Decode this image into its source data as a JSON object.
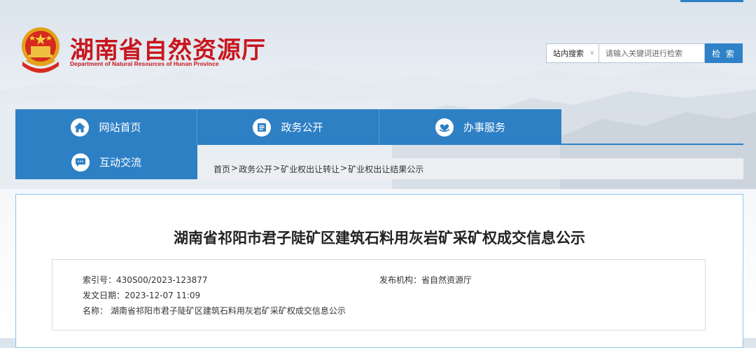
{
  "header": {
    "site_title": "湖南省自然资源厅",
    "site_subtitle": "Department of Natural Resources of Hunan Province",
    "emblem_icon": "national-emblem-icon"
  },
  "search": {
    "scope_label": "站内搜索",
    "scope_caret": "∨",
    "placeholder": "请输入关键词进行检索",
    "button_label": "检 索"
  },
  "nav": {
    "items": [
      {
        "label": "网站首页",
        "icon": "home-icon"
      },
      {
        "label": "政务公开",
        "icon": "document-list-icon"
      },
      {
        "label": "办事服务",
        "icon": "heart-hands-icon"
      },
      {
        "label": "互动交流",
        "icon": "chat-bubble-icon"
      }
    ]
  },
  "breadcrumb": {
    "items": [
      "首页",
      "政务公开",
      "矿业权出让转让",
      "矿业权出让结果公示"
    ],
    "separator": ">"
  },
  "article": {
    "title": "湖南省祁阳市君子陡矿区建筑石料用灰岩矿采矿权成交信息公示",
    "index_label": "索引号：",
    "index_value": "430S00/2023-123877",
    "publisher_label": "发布机构：",
    "publisher_value": "省自然资源厅",
    "date_label": "发文日期：",
    "date_value": "2023-12-07 11:09",
    "name_label": "名称：",
    "name_value": "湖南省祁阳市君子陡矿区建筑石料用灰岩矿采矿权成交信息公示"
  },
  "colors": {
    "brand_red": "#c8161d",
    "nav_blue": "#2e80c5",
    "card_border": "#8ec6ec"
  }
}
